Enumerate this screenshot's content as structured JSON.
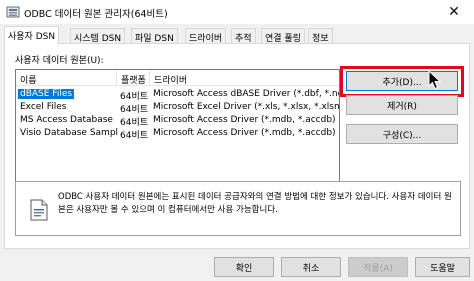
{
  "window": {
    "title": "ODBC 데이터 원본 관리자(64비트)",
    "close_glyph": "✕"
  },
  "tabs": [
    {
      "label": "사용자 DSN"
    },
    {
      "label": "시스템 DSN"
    },
    {
      "label": "파일 DSN"
    },
    {
      "label": "드라이버"
    },
    {
      "label": "추적"
    },
    {
      "label": "연결 풀링"
    },
    {
      "label": "정보"
    }
  ],
  "active_tab": "사용자 DSN",
  "section_label": "사용자 데이터 원본(U):",
  "list": {
    "columns": [
      "이름",
      "플랫폼",
      "드라이버"
    ],
    "rows": [
      {
        "name": "dBASE Files",
        "platform": "64비트",
        "driver": "Microsoft Access dBASE Driver (*.dbf, *.ndx, *.mdx)",
        "selected": true
      },
      {
        "name": "Excel Files",
        "platform": "64비트",
        "driver": "Microsoft Excel Driver (*.xls, *.xlsx, *.xlsm, *.xlsb)",
        "selected": false
      },
      {
        "name": "MS Access Database",
        "platform": "64비트",
        "driver": "Microsoft Access Driver (*.mdb, *.accdb)",
        "selected": false
      },
      {
        "name": "Visio Database Samples",
        "platform": "64비트",
        "driver": "Microsoft Access Driver (*.mdb, *.accdb)",
        "selected": false
      }
    ],
    "scroll_left_glyph": "◀",
    "scroll_right_glyph": "▶"
  },
  "side_buttons": {
    "add": "추가(D)...",
    "remove": "제거(R)",
    "configure": "구성(C)..."
  },
  "info": {
    "text": "ODBC 사용자 데이터 원본에는 표시된 데이터 공급자와의 연결 방법에 대한 정보가 있습니다. 사용자 데이터 원본은 사용자만 볼 수 있으며 이 컴퓨터에서만 사용 가능합니다."
  },
  "footer_buttons": {
    "ok": "확인",
    "cancel": "취소",
    "apply": "적용(A)",
    "help": "도움말"
  },
  "colors": {
    "selection": "#0078d7",
    "highlight_box": "#e4061a"
  },
  "icons": {
    "app": "odbc-app-icon",
    "info": "document-info-icon",
    "close": "close-icon",
    "cursor": "mouse-pointer-icon"
  }
}
